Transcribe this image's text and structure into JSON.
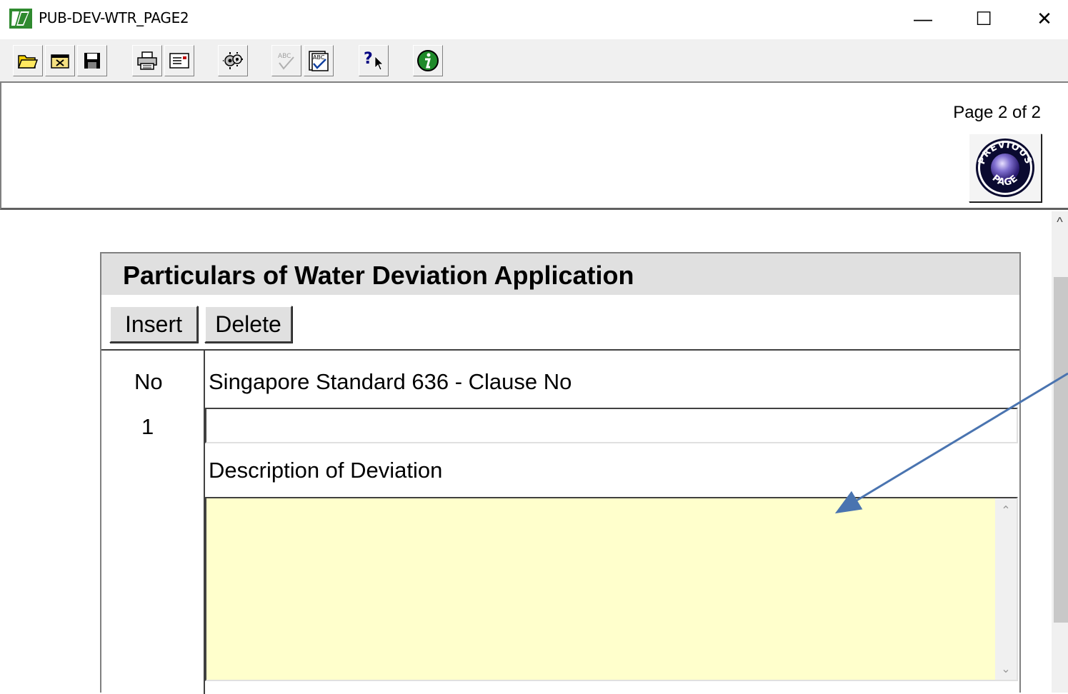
{
  "window": {
    "title": "PUB-DEV-WTR_PAGE2",
    "app_icon": "app-logo-icon",
    "minimize": "—",
    "maximize": "☐",
    "close": "✕"
  },
  "toolbar": {
    "buttons": [
      {
        "name": "open-folder-icon"
      },
      {
        "name": "close-form-icon"
      },
      {
        "name": "save-icon"
      },
      {
        "name": "print-icon"
      },
      {
        "name": "print-preview-icon"
      },
      {
        "name": "gears-icon"
      },
      {
        "name": "spellcheck-disabled-icon"
      },
      {
        "name": "spellcheck-icon"
      },
      {
        "name": "context-help-icon"
      },
      {
        "name": "info-icon"
      }
    ]
  },
  "header": {
    "page_indicator": "Page 2 of 2",
    "previous_page_button": "PREVIOUS PAGE"
  },
  "form": {
    "title": "Particulars of Water Deviation Application",
    "insert_label": "Insert",
    "delete_label": "Delete",
    "col_no_label": "No",
    "row_number": "1",
    "clause_label": "Singapore Standard 636 - Clause No",
    "clause_value": "",
    "description_label": "Description of Deviation",
    "description_value": ""
  },
  "colors": {
    "toolbar_bg": "#f0f0f0",
    "form_header_bg": "#e0e0e0",
    "description_bg": "#ffffcc",
    "annotation_arrow": "#4a74b0"
  }
}
